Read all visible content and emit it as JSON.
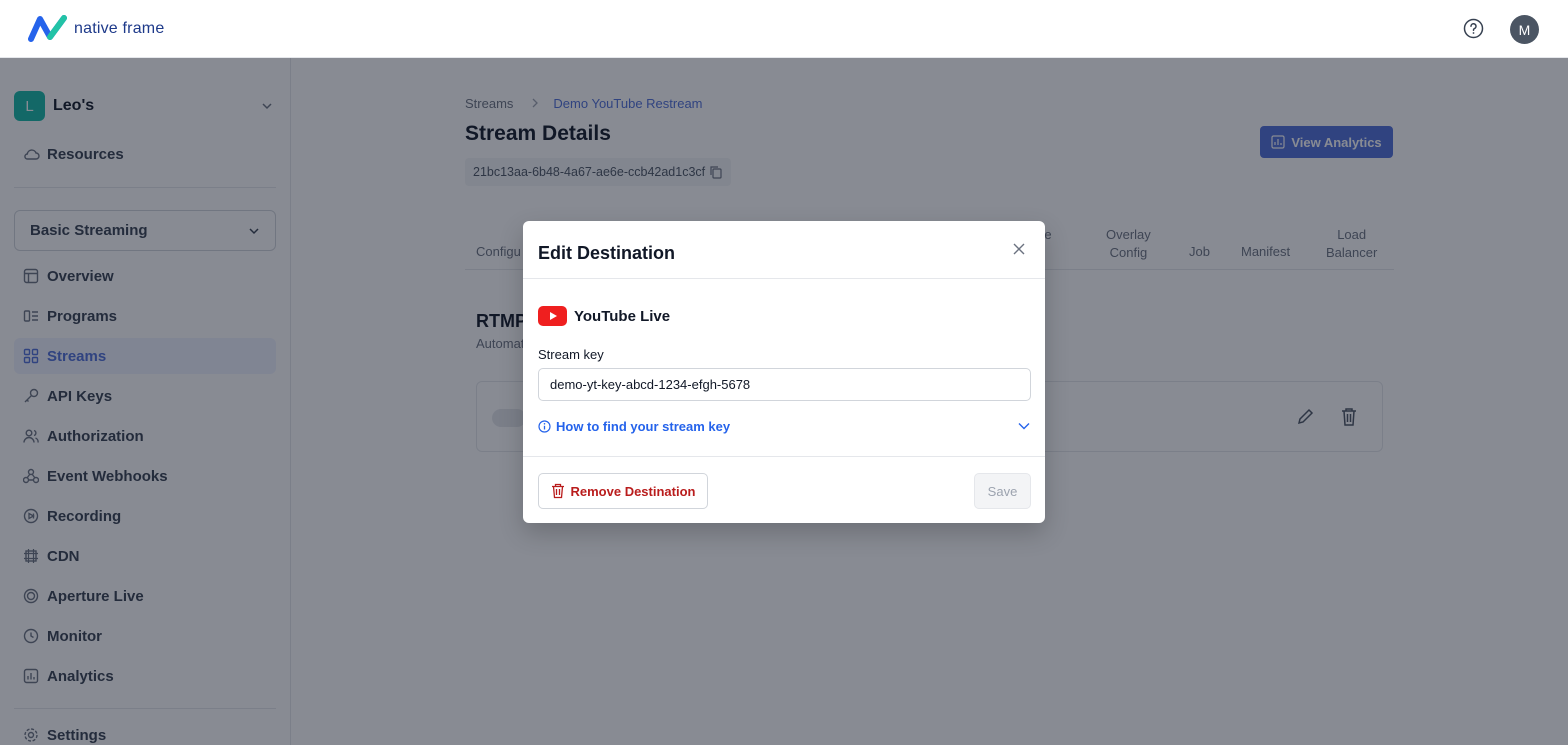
{
  "header": {
    "brand": "native frame",
    "help_icon": "help-circle-icon",
    "user_initial": "M"
  },
  "sidebar": {
    "org": {
      "initial": "L",
      "name": "Leo's"
    },
    "resources_label": "Resources",
    "plan_select": "Basic Streaming",
    "items": [
      {
        "label": "Overview",
        "icon": "layout-icon"
      },
      {
        "label": "Programs",
        "icon": "programs-icon"
      },
      {
        "label": "Streams",
        "icon": "grid-icon",
        "active": true
      },
      {
        "label": "API Keys",
        "icon": "key-icon"
      },
      {
        "label": "Authorization",
        "icon": "users-icon"
      },
      {
        "label": "Event Webhooks",
        "icon": "webhook-icon"
      },
      {
        "label": "Recording",
        "icon": "record-icon"
      },
      {
        "label": "CDN",
        "icon": "cdn-icon"
      },
      {
        "label": "Aperture Live",
        "icon": "aperture-icon"
      },
      {
        "label": "Monitor",
        "icon": "clock-icon"
      },
      {
        "label": "Analytics",
        "icon": "chart-icon"
      }
    ],
    "settings_label": "Settings"
  },
  "main": {
    "breadcrumb": {
      "root": "Streams",
      "current": "Demo YouTube Restream"
    },
    "title": "Stream Details",
    "stream_id": "21bc13aa-6b48-4a67-ae6e-ccb42ad1c3cf",
    "analytics_button": "View Analytics",
    "tabs": [
      "Configu",
      "ive\ng",
      "Overlay\nConfig",
      "Job",
      "Manifest",
      "Load\nBalancer"
    ],
    "section_title": "RTMP",
    "section_sub": "Automat"
  },
  "modal": {
    "title": "Edit Destination",
    "provider": "YouTube Live",
    "field_label": "Stream key",
    "stream_key": "demo-yt-key-abcd-1234-efgh-5678",
    "help_link": "How to find your stream key",
    "remove_button": "Remove Destination",
    "save_button": "Save"
  },
  "colors": {
    "accent": "#4f6fd8",
    "link": "#2563eb",
    "danger": "#b91c1c",
    "youtube": "#ef1f1f",
    "org_avatar": "#14b8a6"
  }
}
